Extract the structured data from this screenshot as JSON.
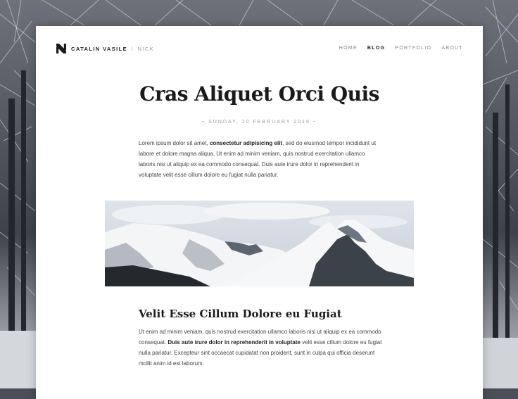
{
  "brand": {
    "name": "CATALIN VASILE",
    "separator": "\\",
    "nick": "NICK"
  },
  "nav": {
    "items": [
      {
        "label": "HOME",
        "active": false
      },
      {
        "label": "BLOG",
        "active": true
      },
      {
        "label": "PORTFOLIO",
        "active": false
      },
      {
        "label": "ABOUT",
        "active": false
      }
    ]
  },
  "post": {
    "title": "Cras Aliquet Orci Quis",
    "date": "~ SUNDAY, 20 FEBRUARY 2016 ~",
    "intro": {
      "before": "Lorem ipsum dolor sit amet, ",
      "bold": "consectetur adipisicing elit",
      "after": ", sed do eiusmod tempor incididunt ut labore et dolore magna aliqua. Ut enim ad minim veniam, quis nostrud exercitation ullamco laboris nisi ut aliquip ex ea commodo consequat. Duis aute irure dolor in reprehenderit in voluptate velit esse cillum dolore eu fugiat nulla pariatur."
    },
    "subheading": "Velit Esse Cillum Dolore eu Fugiat",
    "body": {
      "before": "Ut enim ad minim veniam, quis nostrud exercitation ullamco laboris nisi ut aliquip ex ea commodo consequat. ",
      "bold": "Duis aute irure dolor in reprehenderit in voluptate",
      "after": " velit esse cillum dolore eu fugiat nulla pariatur. Excepteur sint occaecat cupidatat non proident, sunt in culpa qui officia deserunt mollit anim id est laborum."
    }
  }
}
